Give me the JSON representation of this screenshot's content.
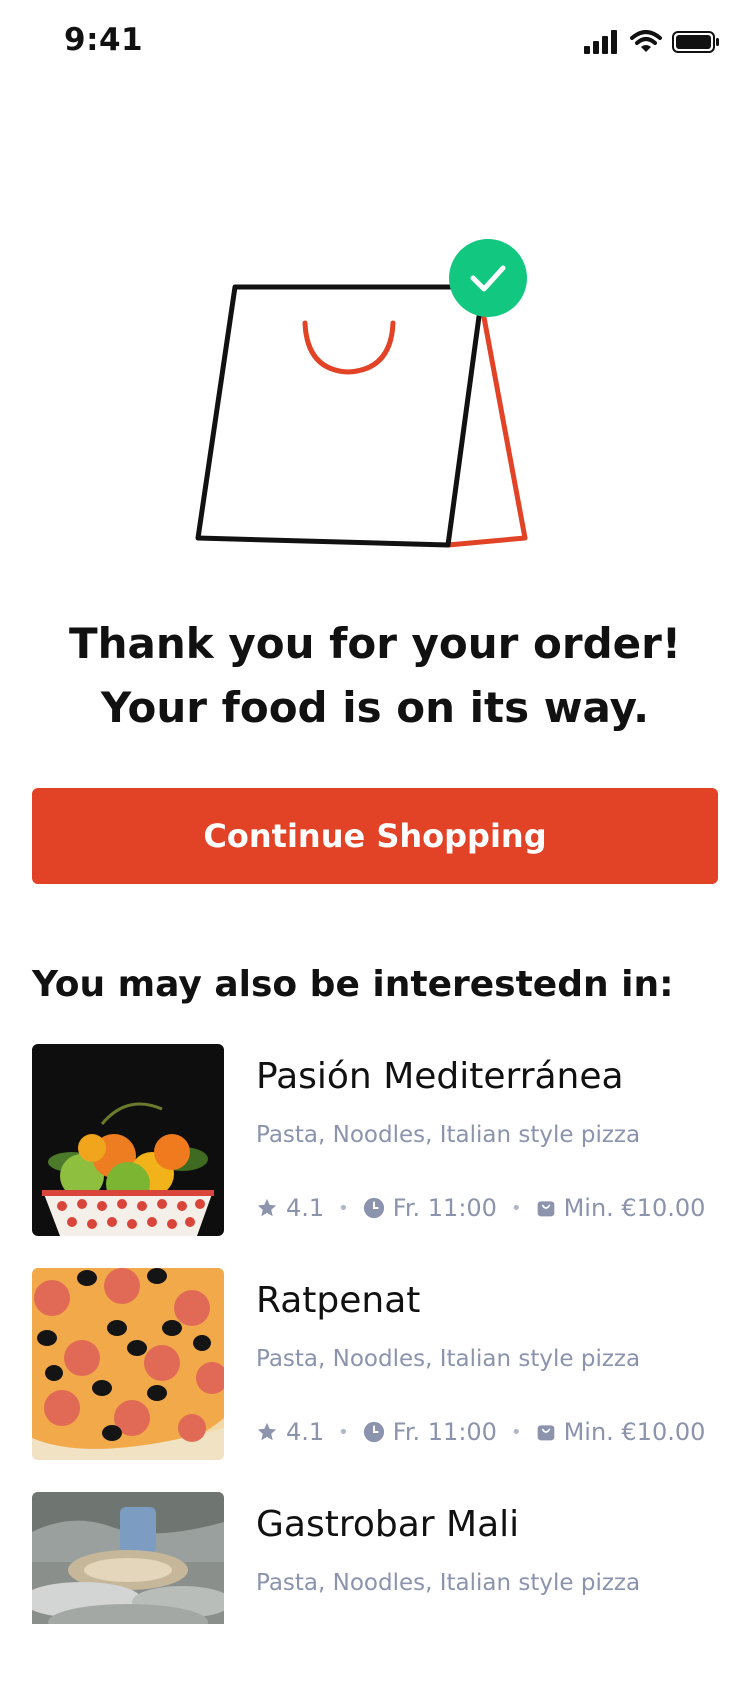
{
  "status_bar": {
    "time": "9:41"
  },
  "colors": {
    "brand": "#e24226",
    "success": "#12c77f",
    "muted": "#8b93ad"
  },
  "confirmation": {
    "illustration": "shopping-bag-with-check",
    "message": "Thank you for your order! Your food is on its way."
  },
  "actions": {
    "continue_label": "Continue Shopping"
  },
  "recommendations": {
    "title": "You may also be interestedn in:",
    "items": [
      {
        "name": "Pasión Mediterránea",
        "cuisine": "Pasta, Noodles, Italian style pizza",
        "rating": "4.1",
        "hours": "Fr. 11:00",
        "min_order": "Min. €10.00",
        "image": "fruit-bowl"
      },
      {
        "name": "Ratpenat",
        "cuisine": "Pasta, Noodles, Italian style pizza",
        "rating": "4.1",
        "hours": "Fr. 11:00",
        "min_order": "Min. €10.00",
        "image": "pepperoni-olive-pizza"
      },
      {
        "name": "Gastrobar Mali",
        "cuisine": "Pasta, Noodles, Italian style pizza",
        "image": "street-food-dish"
      }
    ]
  }
}
